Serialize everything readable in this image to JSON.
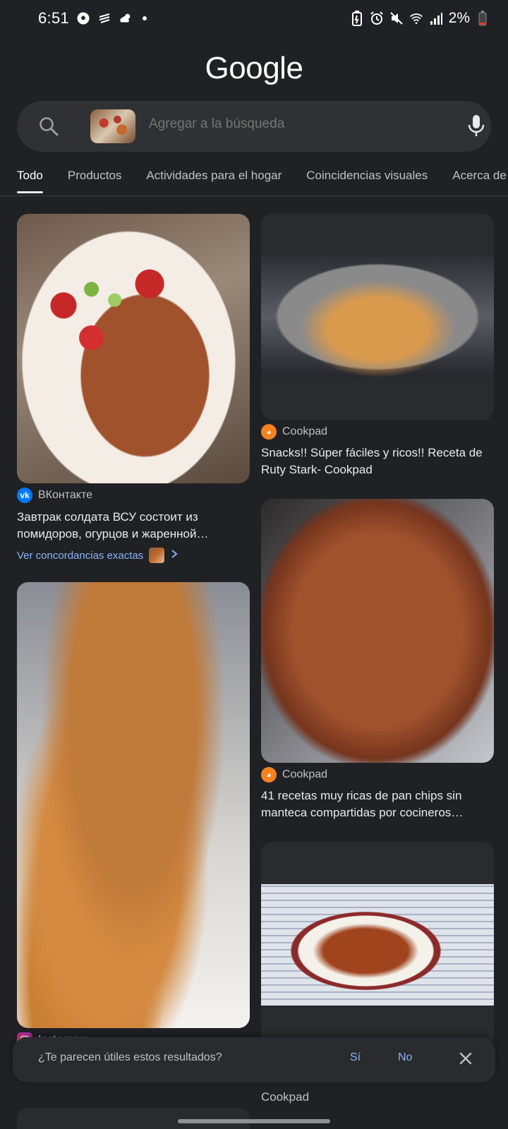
{
  "status_bar": {
    "time": "6:51",
    "battery": "2%"
  },
  "header": {
    "logo": "Google"
  },
  "search": {
    "placeholder": "Agregar a la búsqueda"
  },
  "tabs": [
    {
      "label": "Todo",
      "active": true
    },
    {
      "label": "Productos"
    },
    {
      "label": "Actividades para el hogar"
    },
    {
      "label": "Coincidencias visuales"
    },
    {
      "label": "Acerca de"
    }
  ],
  "results": [
    {
      "source": "ВКонтакте",
      "source_icon": "vk-icon",
      "title": "Завтрак солдата ВСУ состоит из помидоров, огурцов и жаренной…",
      "exact_match": "Ver concordancias exactas"
    },
    {
      "source": "Cookpad",
      "source_icon": "cookpad-icon",
      "title": "Snacks!! Súper fáciles y ricos!! Receta de Ruty Stark- Cookpad"
    },
    {
      "source": "Cookpad",
      "source_icon": "cookpad-icon",
      "title": "41 recetas muy ricas de pan chips sin manteca compartidas por cocineros…"
    },
    {
      "source": "Instagram",
      "source_icon": "instagram-icon",
      "title": ""
    },
    {
      "source": "Cookpad",
      "source_icon": "cookpad-icon",
      "title": "Cookpad"
    }
  ],
  "feedback": {
    "question": "¿Te parecen útiles estos resultados?",
    "yes": "Sí",
    "no": "No"
  },
  "colors": {
    "background": "#202124",
    "link": "#8ab4f8",
    "vk": "#0077ff",
    "cookpad": "#f58220",
    "instagram": "#d62976"
  }
}
